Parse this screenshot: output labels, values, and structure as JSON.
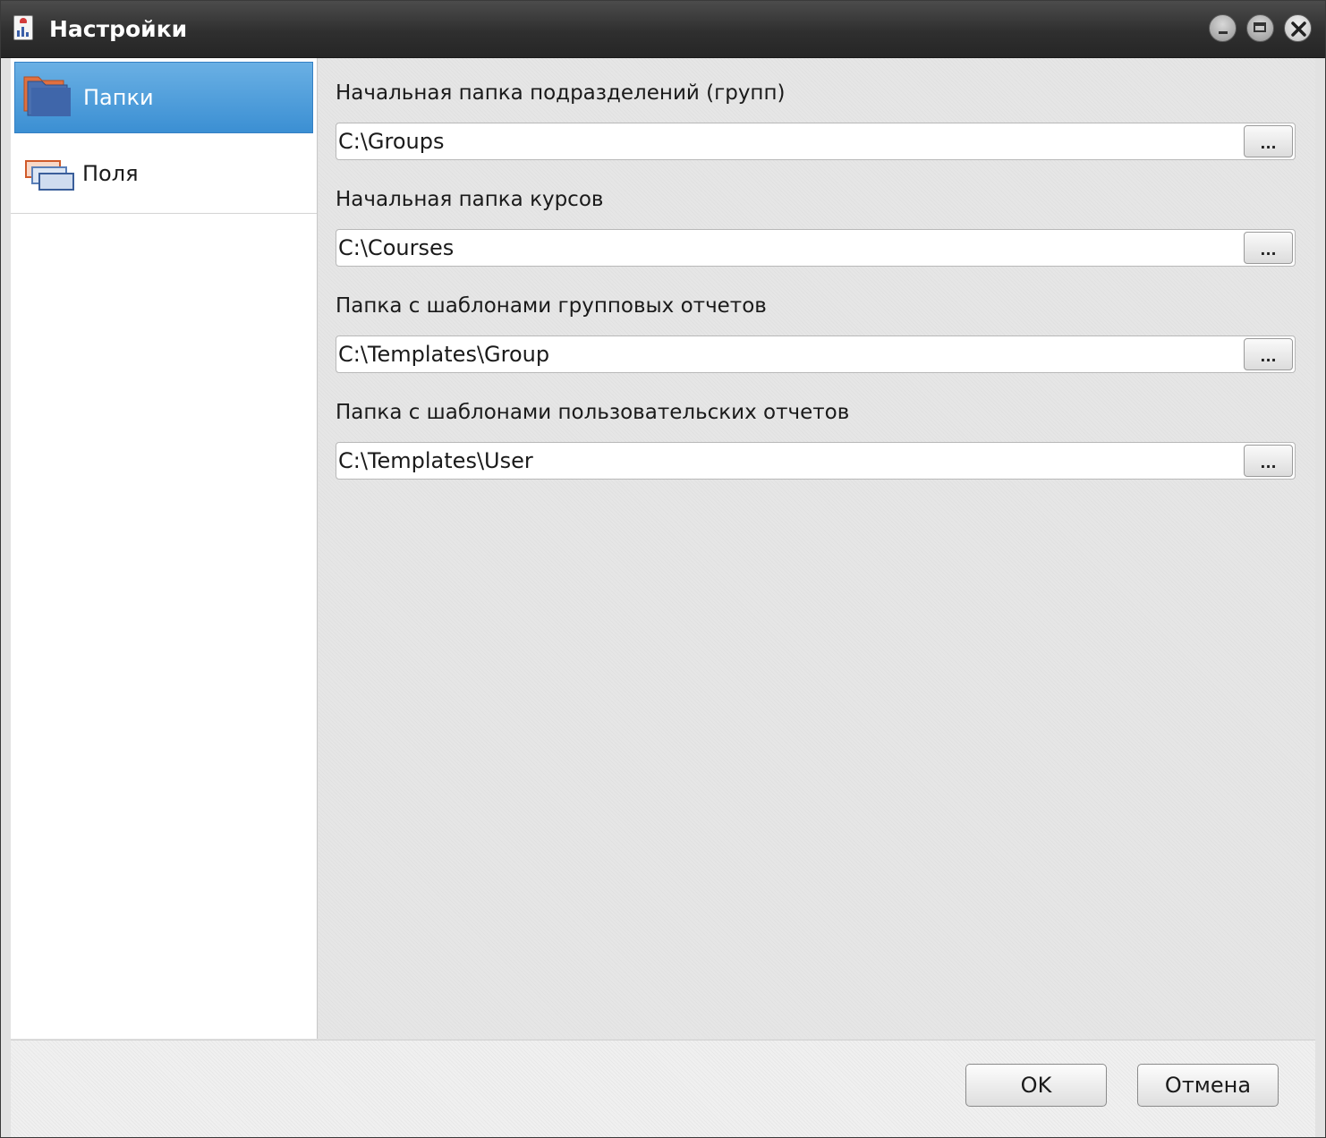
{
  "window": {
    "title": "Настройки",
    "app_icon": "report-app-icon",
    "controls": [
      "minimize-icon",
      "maximize-icon",
      "close-icon"
    ]
  },
  "sidebar": {
    "items": [
      {
        "label": "Папки",
        "icon": "folders-icon",
        "selected": true
      },
      {
        "label": "Поля",
        "icon": "fields-icon",
        "selected": false
      }
    ]
  },
  "main": {
    "fields": [
      {
        "label": "Начальная папка подразделений (групп)",
        "value": "C:\\Groups",
        "browse": "..."
      },
      {
        "label": "Начальная папка курсов",
        "value": "C:\\Courses",
        "browse": "..."
      },
      {
        "label": "Папка с шаблонами групповых отчетов",
        "value": "C:\\Templates\\Group",
        "browse": "..."
      },
      {
        "label": "Папка с шаблонами пользовательских отчетов",
        "value": "C:\\Templates\\User",
        "browse": "..."
      }
    ]
  },
  "footer": {
    "ok_label": "OK",
    "cancel_label": "Отмена"
  },
  "colors": {
    "selection": "#4a9ddc",
    "titlebar": "#333333",
    "accent_orange": "#e06a3a"
  }
}
